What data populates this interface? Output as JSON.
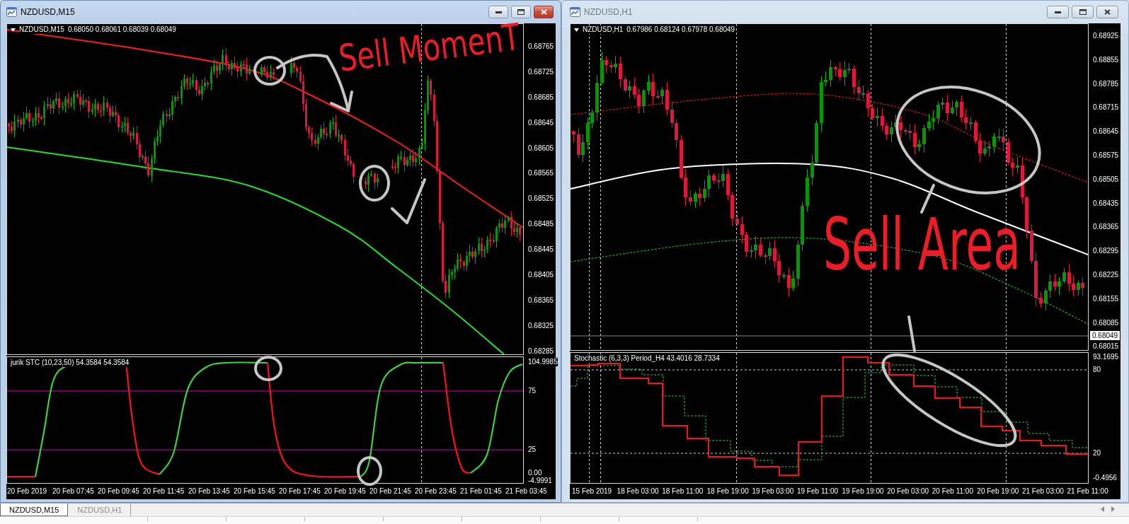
{
  "windows": [
    {
      "title": "NZDUSD,M15",
      "active": true,
      "chart": {
        "symbol": "NZDUSD,M15",
        "quotes": "0.68050 0.68061 0.68039 0.68049",
        "price_axis": [
          "0.68765",
          "0.68725",
          "0.68685",
          "0.68645",
          "0.68605",
          "0.68565",
          "0.68525",
          "0.68485",
          "0.68445",
          "0.68405",
          "0.68365",
          "0.68325",
          "0.68285"
        ]
      },
      "indicator": {
        "kind": "stc",
        "title": "jurik STC (10,23,50) 54.3584 54.3584",
        "axis": [
          "104.9985",
          "75",
          "25",
          "0.00",
          "-4.9991"
        ]
      },
      "time_axis": [
        "20 Feb 2019",
        "20 Feb 07:45",
        "20 Feb 09:45",
        "20 Feb 11:45",
        "20 Feb 13:45",
        "20 Feb 15:45",
        "20 Feb 17:45",
        "20 Feb 19:45",
        "20 Feb 21:45",
        "20 Feb 23:45",
        "21 Feb 01:45",
        "21 Feb 03:45"
      ]
    },
    {
      "title": "NZDUSD,H1",
      "active": false,
      "chart": {
        "symbol": "NZDUSD,H1",
        "quotes": "0.67986 0.68124 0.67978 0.68049",
        "price_axis": [
          "0.68925",
          "0.68855",
          "0.68785",
          "0.68715",
          "0.68645",
          "0.68575",
          "0.68505",
          "0.68435",
          "0.68365",
          "0.68295",
          "0.68225",
          "0.68155",
          "0.68085",
          "0.68015"
        ],
        "current_price": "0.68049"
      },
      "indicator": {
        "kind": "stochastic",
        "title": "Stochastic (6,3,3) Period_H4 43.4016 28.7334",
        "axis": [
          "93.1695",
          "80",
          "20",
          "-0.4956"
        ]
      },
      "time_axis": [
        "15 Feb 2019",
        "18 Feb 03:00",
        "18 Feb 11:00",
        "18 Feb 19:00",
        "19 Feb 03:00",
        "19 Feb 11:00",
        "19 Feb 19:00",
        "20 Feb 03:00",
        "20 Feb 11:00",
        "20 Feb 19:00",
        "21 Feb 03:00",
        "21 Feb 11:00"
      ]
    }
  ],
  "annotations": [
    {
      "text": "Sell MomenT"
    },
    {
      "text": "Sell Area"
    }
  ],
  "tabs": [
    {
      "label": "NZDUSD,M15",
      "selected": true
    },
    {
      "label": "NZDUSD,H1",
      "selected": false
    }
  ]
}
